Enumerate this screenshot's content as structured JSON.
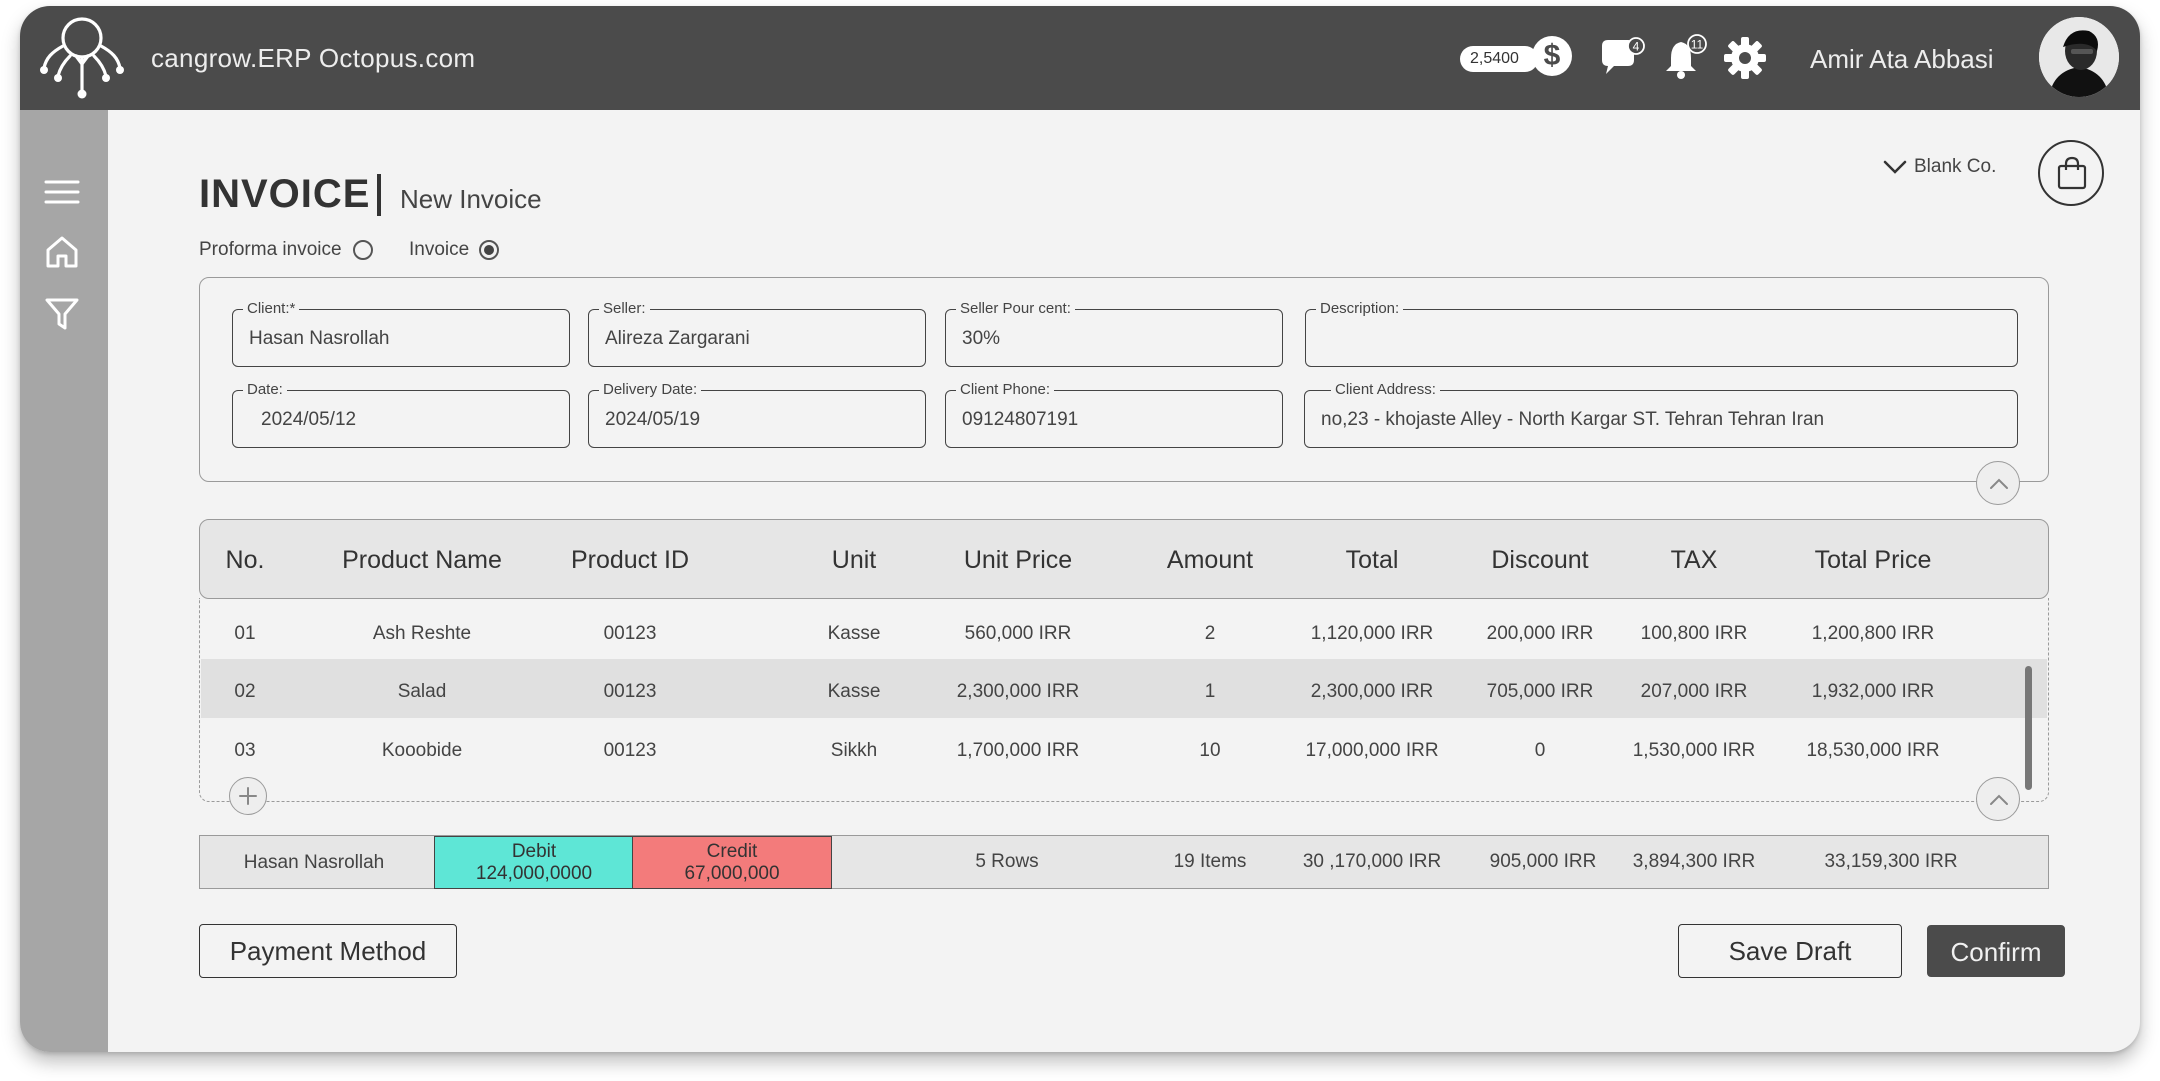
{
  "header": {
    "app_title": "cangrow.ERP Octopus.com",
    "coin_balance": "2,5400",
    "currency_icon": "dollar-icon",
    "messages_count": "4",
    "notifications_count": "11",
    "user_name": "Amir Ata Abbasi"
  },
  "sidebar": {
    "items": [
      {
        "icon": "menu-icon"
      },
      {
        "icon": "home-icon"
      },
      {
        "icon": "filter-icon"
      }
    ]
  },
  "invoice": {
    "title": "INVOICE",
    "subtitle": "New Invoice",
    "company": "Blank Co.",
    "types": [
      {
        "label": "Proforma invoice",
        "selected": false
      },
      {
        "label": "Invoice",
        "selected": true
      }
    ]
  },
  "form": {
    "client": {
      "label": "Client:*",
      "value": "Hasan Nasrollah"
    },
    "seller": {
      "label": "Seller:",
      "value": "Alireza Zargarani"
    },
    "seller_percent": {
      "label": "Seller Pour cent:",
      "value": "30%"
    },
    "description": {
      "label": "Description:",
      "value": ""
    },
    "date": {
      "label": "Date:",
      "value": "2024/05/12"
    },
    "delivery_date": {
      "label": "Delivery Date:",
      "value": "2024/05/19"
    },
    "client_phone": {
      "label": "Client Phone:",
      "value": "09124807191"
    },
    "client_address": {
      "label": "Client Address:",
      "value": "no,23 - khojaste Alley - North Kargar ST. Tehran Tehran Iran"
    }
  },
  "table": {
    "columns": [
      "No.",
      "Product Name",
      "Product ID",
      "Unit",
      "Unit Price",
      "Amount",
      "Total",
      "Discount",
      "TAX",
      "Total Price"
    ],
    "rows": [
      [
        "01",
        "Ash Reshte",
        "00123",
        "Kasse",
        "560,000 IRR",
        "2",
        "1,120,000 IRR",
        "200,000 IRR",
        "100,800 IRR",
        "1,200,800 IRR"
      ],
      [
        "02",
        "Salad",
        "00123",
        "Kasse",
        "2,300,000 IRR",
        "1",
        "2,300,000 IRR",
        "705,000 IRR",
        "207,000 IRR",
        "1,932,000 IRR"
      ],
      [
        "03",
        "Kooobide",
        "00123",
        "Sikkh",
        "1,700,000 IRR",
        "10",
        "17,000,000 IRR",
        "0",
        "1,530,000 IRR",
        "18,530,000 IRR"
      ]
    ],
    "highlighted_row": 1
  },
  "totals": {
    "client": "Hasan Nasrollah",
    "debit_label": "Debit",
    "debit_value": "124,000,0000",
    "credit_label": "Credit",
    "credit_value": "67,000,000",
    "rows": "5 Rows",
    "items": "19 Items",
    "total": "30 ,170,000 IRR",
    "discount": "905,000 IRR",
    "tax": "3,894,300 IRR",
    "total_price": "33,159,300 IRR"
  },
  "actions": {
    "payment_method": "Payment Method",
    "save_draft": "Save Draft",
    "confirm": "Confirm"
  },
  "colors": {
    "topbar": "#4b4b4b",
    "sidebar": "#a6a6a6",
    "debit": "#5ee6d6",
    "credit": "#f37b7b",
    "confirm": "#4b4b4b"
  }
}
